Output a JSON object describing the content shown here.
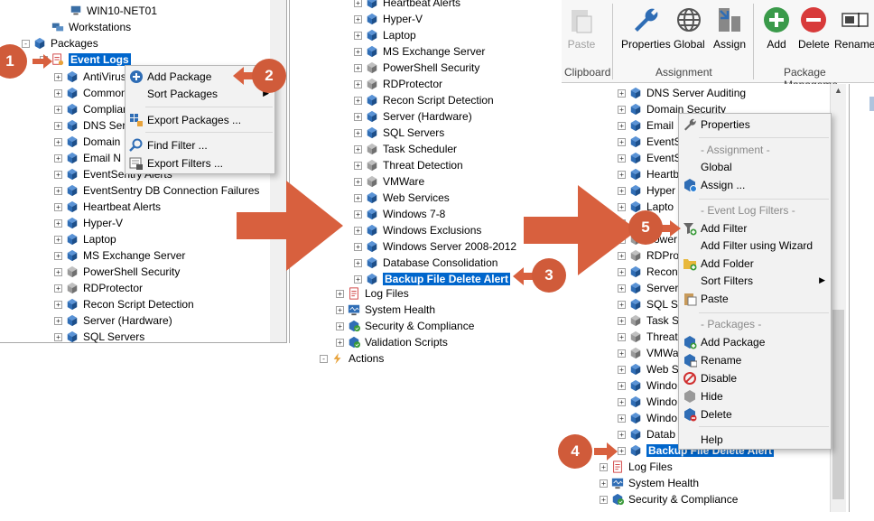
{
  "panel1": {
    "tree": [
      {
        "label": "WIN10-NET01",
        "icon": "computer-icon",
        "expander": "none"
      },
      {
        "label": "Workstations",
        "icon": "computer-group-icon",
        "expander": "none"
      },
      {
        "label": "Packages",
        "icon": "packages-grid-icon",
        "expander": "-"
      },
      {
        "label": "Event Logs",
        "icon": "event-log-icon",
        "expander": "-"
      },
      {
        "label": "AntiVirus",
        "icon": "package-icon",
        "expander": "+"
      },
      {
        "label": "Common",
        "icon": "package-icon",
        "expander": "+"
      },
      {
        "label": "Compliance",
        "icon": "package-icon",
        "expander": "+"
      },
      {
        "label": "DNS Server",
        "icon": "package-icon",
        "expander": "+"
      },
      {
        "label": "Domain",
        "icon": "package-icon",
        "expander": "+"
      },
      {
        "label": "Email N",
        "icon": "package-icon",
        "expander": "+"
      },
      {
        "label": "EventSentry Alerts",
        "icon": "package-icon",
        "expander": "+"
      },
      {
        "label": "EventSentry DB Connection Failures",
        "icon": "package-icon",
        "expander": "+"
      },
      {
        "label": "Heartbeat Alerts",
        "icon": "package-icon",
        "expander": "+"
      },
      {
        "label": "Hyper-V",
        "icon": "package-icon",
        "expander": "+"
      },
      {
        "label": "Laptop",
        "icon": "package-icon",
        "expander": "+"
      },
      {
        "label": "MS Exchange Server",
        "icon": "package-icon",
        "expander": "+"
      },
      {
        "label": "PowerShell Security",
        "icon": "package-grey-icon",
        "expander": "+"
      },
      {
        "label": "RDProtector",
        "icon": "package-grey-icon",
        "expander": "+"
      },
      {
        "label": "Recon Script Detection",
        "icon": "package-icon",
        "expander": "+"
      },
      {
        "label": "Server (Hardware)",
        "icon": "package-icon",
        "expander": "+"
      },
      {
        "label": "SQL Servers",
        "icon": "package-icon",
        "expander": "+"
      }
    ],
    "menu": [
      {
        "label": "Add Package",
        "icon": "add-circle-icon"
      },
      {
        "label": "Sort Packages",
        "icon": "",
        "submenu": true
      },
      {
        "label": "Export Packages ...",
        "icon": "export-icon"
      },
      {
        "label": "Find Filter ...",
        "icon": "search-icon"
      },
      {
        "label": "Export Filters ...",
        "icon": "export-filters-icon"
      }
    ]
  },
  "panel2": {
    "tree": [
      {
        "label": "Heartbeat Alerts"
      },
      {
        "label": "Hyper-V"
      },
      {
        "label": "Laptop"
      },
      {
        "label": "MS Exchange Server"
      },
      {
        "label": "PowerShell Security"
      },
      {
        "label": "RDProtector"
      },
      {
        "label": "Recon Script Detection"
      },
      {
        "label": "Server (Hardware)"
      },
      {
        "label": "SQL Servers"
      },
      {
        "label": "Task Scheduler"
      },
      {
        "label": "Threat Detection"
      },
      {
        "label": "VMWare"
      },
      {
        "label": "Web Services"
      },
      {
        "label": "Windows 7-8"
      },
      {
        "label": "Windows Exclusions"
      },
      {
        "label": "Windows Server 2008-2012"
      },
      {
        "label": "Database Consolidation"
      },
      {
        "label": "Backup File Delete Alert"
      }
    ],
    "bottom": [
      {
        "label": "Log Files",
        "icon": "log-files-icon"
      },
      {
        "label": "System Health",
        "icon": "system-health-icon"
      },
      {
        "label": "Security & Compliance",
        "icon": "security-icon"
      },
      {
        "label": "Validation Scripts",
        "icon": "validation-icon"
      },
      {
        "label": "Actions",
        "icon": "lightning-icon"
      }
    ]
  },
  "ribbon": {
    "buttons": [
      {
        "label": "Paste",
        "icon": "paste-icon",
        "disabled": true
      },
      {
        "label": "Properties",
        "icon": "wrench-icon"
      },
      {
        "label": "Global",
        "icon": "globe-icon"
      },
      {
        "label": "Assign",
        "icon": "assign-icon"
      },
      {
        "label": "Add",
        "icon": "add-green-icon"
      },
      {
        "label": "Delete",
        "icon": "delete-red-icon"
      },
      {
        "label": "Rename",
        "icon": "rename-icon"
      }
    ],
    "groups": [
      "Clipboard",
      "Assignment",
      "Package Manageme"
    ]
  },
  "panel3": {
    "tree": [
      "DNS Server Auditing",
      "Domain Security",
      "Email",
      "EventS",
      "EventS",
      "Heartb",
      "Hyper",
      "Lapto",
      "",
      "Power",
      "RDPro",
      "Recon",
      "Server",
      "SQL Se",
      "Task S",
      "Threat",
      "VMWa",
      "Web S",
      "Windo",
      "Windo",
      "Windo",
      "Datab",
      "Backup File Delete Alert"
    ],
    "bottom": [
      {
        "label": "Log Files"
      },
      {
        "label": "System Health"
      },
      {
        "label": "Security & Compliance"
      }
    ],
    "menu": {
      "properties": "Properties",
      "hdr_assignment": "- Assignment -",
      "global": "Global",
      "assign": "Assign ...",
      "hdr_filters": "- Event Log Filters -",
      "add_filter": "Add Filter",
      "add_filter_wizard": "Add Filter using Wizard",
      "add_folder": "Add Folder",
      "sort_filters": "Sort Filters",
      "paste": "Paste",
      "hdr_packages": "- Packages -",
      "add_package": "Add Package",
      "rename": "Rename",
      "disable": "Disable",
      "hide": "Hide",
      "delete": "Delete",
      "help": "Help"
    }
  },
  "badges": [
    "1",
    "2",
    "3",
    "4",
    "5"
  ],
  "colors": {
    "selection": "#0066cc",
    "badge": "#d05b3a",
    "arrow": "#d8603e",
    "package_blue": "#2f6db5"
  }
}
